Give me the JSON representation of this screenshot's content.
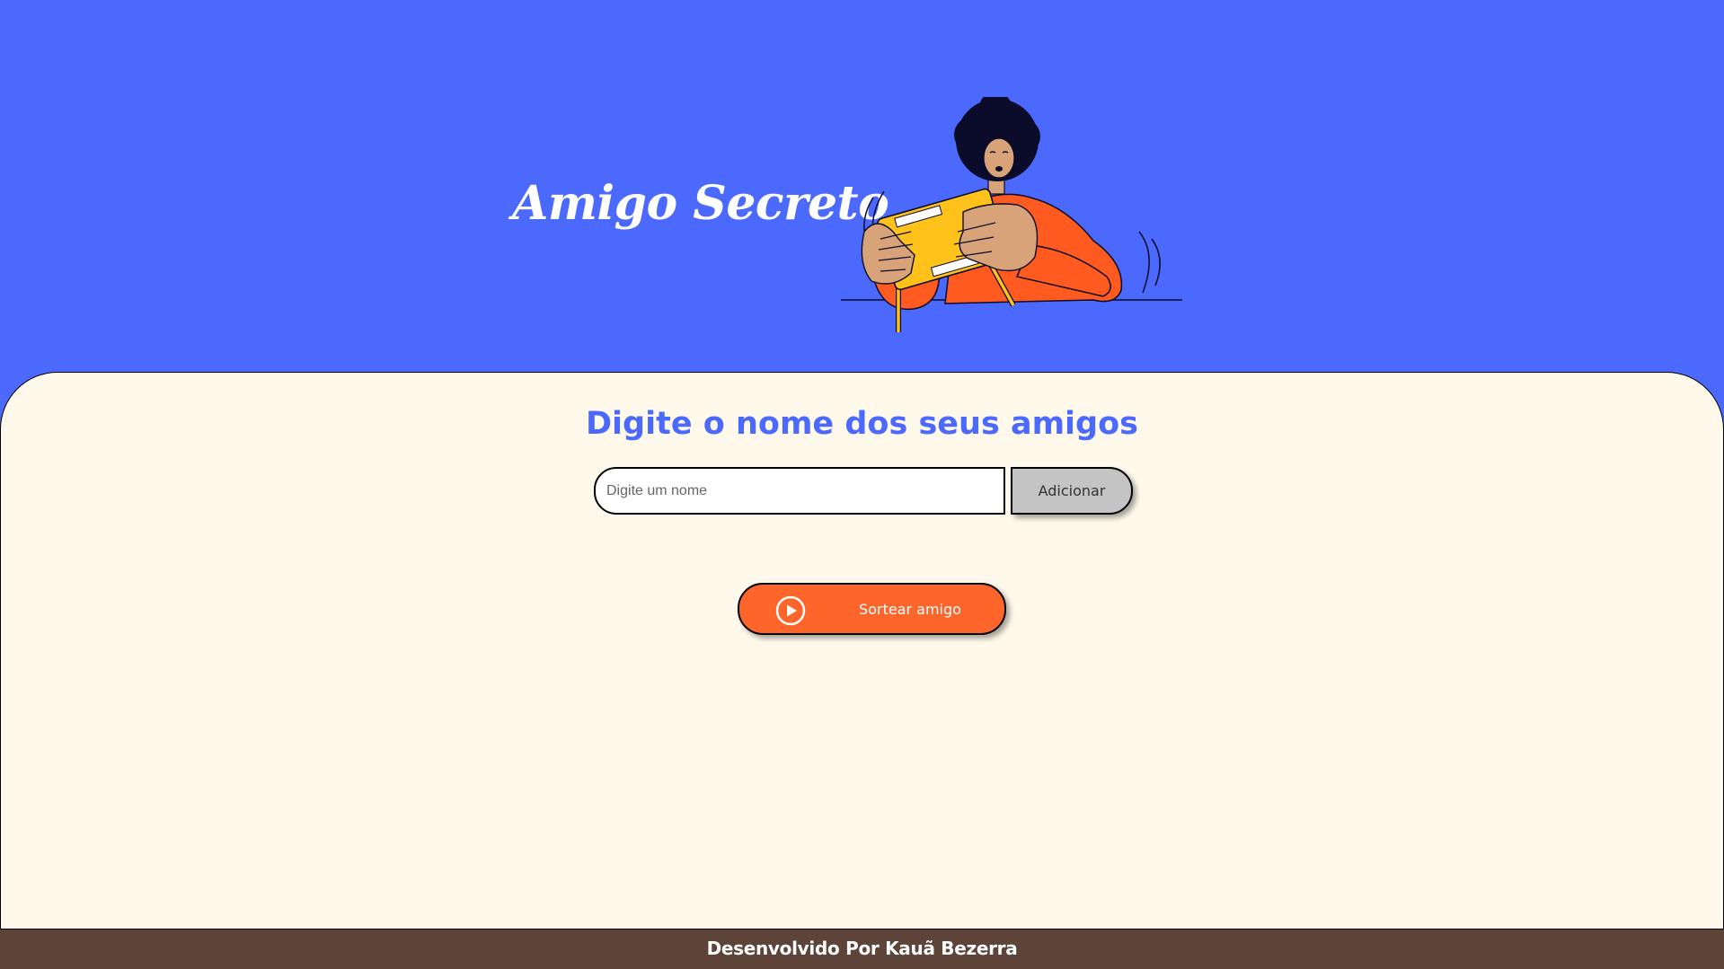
{
  "header": {
    "title": "Amigo Secreto",
    "illustration_icon": "person-playing-handheld-game-illustration"
  },
  "main": {
    "section_title": "Digite o nome dos seus amigos",
    "name_input": {
      "placeholder": "Digite um nome",
      "value": ""
    },
    "add_button_label": "Adicionar",
    "draw_button": {
      "label": "Sortear amigo",
      "icon": "play-circle-icon"
    }
  },
  "footer": {
    "text": "Desenvolvido Por Kauã Bezerra"
  },
  "colors": {
    "header_bg": "#4B69FD",
    "main_bg": "#FFF9EB",
    "title_accent": "#4B69FD",
    "add_button_bg": "#C4C4C4",
    "draw_button_bg": "#FE652B",
    "footer_bg": "#5E4338"
  }
}
